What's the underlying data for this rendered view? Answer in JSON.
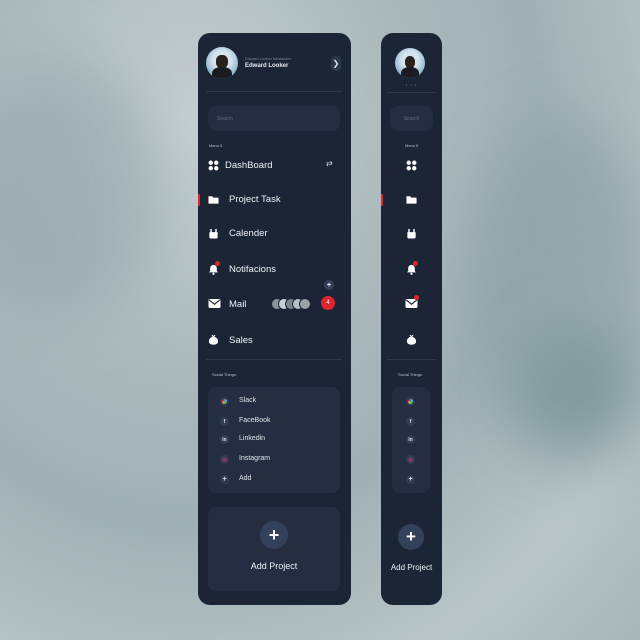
{
  "profile": {
    "subtitle": "Edward Looker fullstacker",
    "name": "Edward Looker",
    "expand_icon": "chevron-right-icon",
    "collapsed_dots": "• • •"
  },
  "search": {
    "placeholder": "Search"
  },
  "menu": {
    "caption": "Menu 6",
    "items": [
      {
        "label": "DashBoard",
        "icon": "grid-icon"
      },
      {
        "label": "Project Task",
        "icon": "folder-icon"
      },
      {
        "label": "Calender",
        "icon": "calendar-icon"
      },
      {
        "label": "Notifacions",
        "icon": "bell-icon"
      },
      {
        "label": "Mail",
        "icon": "mail-icon",
        "badge": "4"
      },
      {
        "label": "Sales",
        "icon": "bag-icon"
      }
    ],
    "dashboard_toggle": "⇄",
    "mail_add": "+"
  },
  "social": {
    "caption": "Social Things",
    "items": [
      {
        "label": "Slack",
        "glyph": ""
      },
      {
        "label": "FaceBook",
        "glyph": "f"
      },
      {
        "label": "Linkedin",
        "glyph": "in"
      },
      {
        "label": "Instagram",
        "glyph": "◎"
      },
      {
        "label": "Add",
        "glyph": "+"
      }
    ]
  },
  "add_project": {
    "label": "Add Project",
    "glyph": "+"
  },
  "colors": {
    "panel": "#1c2536",
    "card": "#242e40",
    "accent": "#e0262d"
  }
}
